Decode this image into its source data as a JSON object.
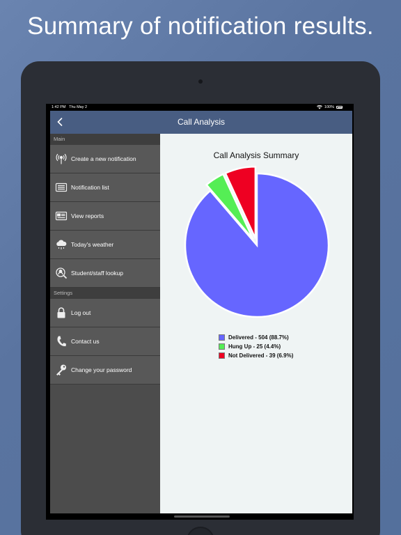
{
  "headline": "Summary of notification results.",
  "status_bar": {
    "time": "1:42 PM",
    "date": "Thu May 2",
    "battery": "100%"
  },
  "navbar": {
    "title": "Call Analysis"
  },
  "sidebar": {
    "sections": [
      {
        "header": "Main",
        "items": [
          {
            "label": "Create a new notification",
            "icon": "broadcast-icon"
          },
          {
            "label": "Notification list",
            "icon": "list-icon"
          },
          {
            "label": "View reports",
            "icon": "report-icon"
          },
          {
            "label": "Today's weather",
            "icon": "weather-icon"
          },
          {
            "label": "Student/staff lookup",
            "icon": "person-search-icon"
          }
        ]
      },
      {
        "header": "Settings",
        "items": [
          {
            "label": "Log out",
            "icon": "lock-icon"
          },
          {
            "label": "Contact us",
            "icon": "phone-icon"
          },
          {
            "label": "Change your password",
            "icon": "key-icon"
          }
        ]
      }
    ]
  },
  "chart_data": {
    "type": "pie",
    "title": "Call Analysis Summary",
    "slices": [
      {
        "label": "Delivered - 504 (88.7%)",
        "value": 504,
        "percent": 88.7,
        "color": "#6666ff",
        "exploded": false
      },
      {
        "label": "Hung Up - 25 (4.4%)",
        "value": 25,
        "percent": 4.4,
        "color": "#55ee55",
        "exploded": true
      },
      {
        "label": "Not Delivered - 39 (6.9%)",
        "value": 39,
        "percent": 6.9,
        "color": "#ee0022",
        "exploded": true
      }
    ],
    "legend_position": "bottom"
  },
  "colors": {
    "navbar": "#485d82",
    "sidebar": "#585858",
    "background": "#5a74a0"
  }
}
